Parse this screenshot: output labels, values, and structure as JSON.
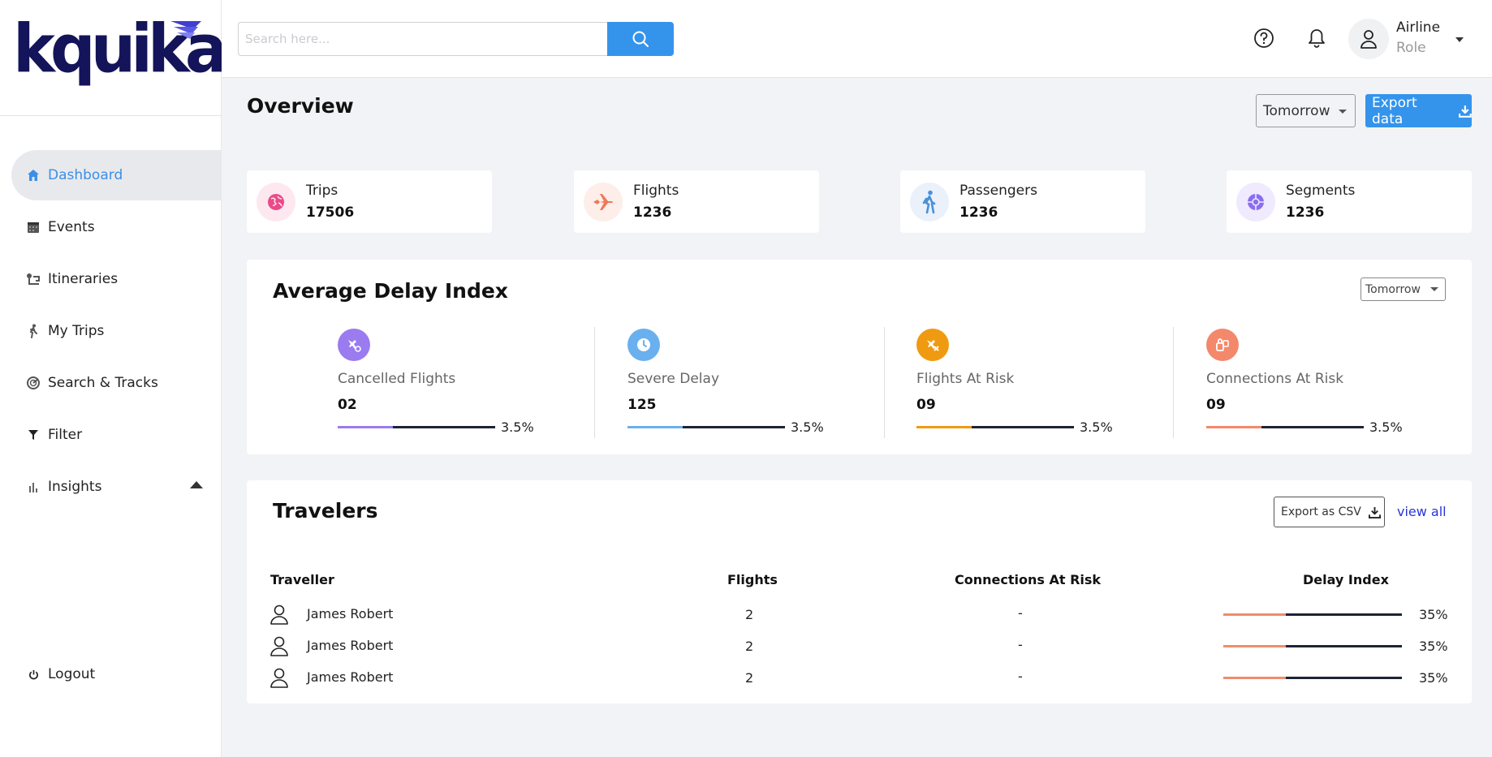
{
  "brand": {
    "logo_text": "kquika"
  },
  "sidebar": {
    "items": [
      {
        "label": "Dashboard",
        "icon": "home-icon",
        "active": true
      },
      {
        "label": "Events",
        "icon": "calendar-icon"
      },
      {
        "label": "Itineraries",
        "icon": "route-icon"
      },
      {
        "label": "My Trips",
        "icon": "traveler-icon"
      },
      {
        "label": "Search & Tracks",
        "icon": "radar-icon"
      },
      {
        "label": "Filter",
        "icon": "filter-icon"
      },
      {
        "label": "Insights",
        "icon": "bar-chart-icon"
      }
    ],
    "logout_label": "Logout"
  },
  "header": {
    "search_placeholder": "Search here...",
    "user_name": "Airline",
    "user_role": "Role"
  },
  "overview": {
    "title": "Overview",
    "period": "Tomorrow",
    "export_label": "Export data"
  },
  "stats": [
    {
      "label": "Trips",
      "value": "17506",
      "icon": "globe-icon",
      "color": "#e94b8a"
    },
    {
      "label": "Flights",
      "value": "1236",
      "icon": "airplane-icon",
      "color": "#f0775a"
    },
    {
      "label": "Passengers",
      "value": "1236",
      "icon": "walking-passenger-icon",
      "color": "#4a90d9"
    },
    {
      "label": "Segments",
      "value": "1236",
      "icon": "segments-icon",
      "color": "#8a6df0"
    }
  ],
  "delay_index": {
    "title": "Average Delay Index",
    "period": "Tomorrow",
    "metrics": [
      {
        "label": "Cancelled Flights",
        "value": "02",
        "pct": "3.5%",
        "fill": 0.35,
        "color": "#9a7bf0",
        "icon": "cancelled-flight-icon"
      },
      {
        "label": "Severe Delay",
        "value": "125",
        "pct": "3.5%",
        "fill": 0.35,
        "color": "#6ab0ef",
        "icon": "clock-icon"
      },
      {
        "label": "Flights At Risk",
        "value": "09",
        "pct": "3.5%",
        "fill": 0.35,
        "color": "#f09a12",
        "icon": "risk-flight-icon"
      },
      {
        "label": "Connections At Risk",
        "value": "09",
        "pct": "3.5%",
        "fill": 0.35,
        "color": "#f4886b",
        "icon": "connection-icon"
      }
    ]
  },
  "travelers": {
    "title": "Travelers",
    "export_csv_label": "Export as CSV",
    "view_all_label": "view all",
    "columns": [
      "Traveller",
      "Flights",
      "Connections At Risk",
      "Delay Index"
    ],
    "rows": [
      {
        "name": "James Robert",
        "flights": "2",
        "connections": "-",
        "delay_pct": "35%",
        "delay_fill": 0.35
      },
      {
        "name": "James Robert",
        "flights": "2",
        "connections": "-",
        "delay_pct": "35%",
        "delay_fill": 0.35
      },
      {
        "name": "James Robert",
        "flights": "2",
        "connections": "-",
        "delay_pct": "35%",
        "delay_fill": 0.35
      }
    ]
  }
}
